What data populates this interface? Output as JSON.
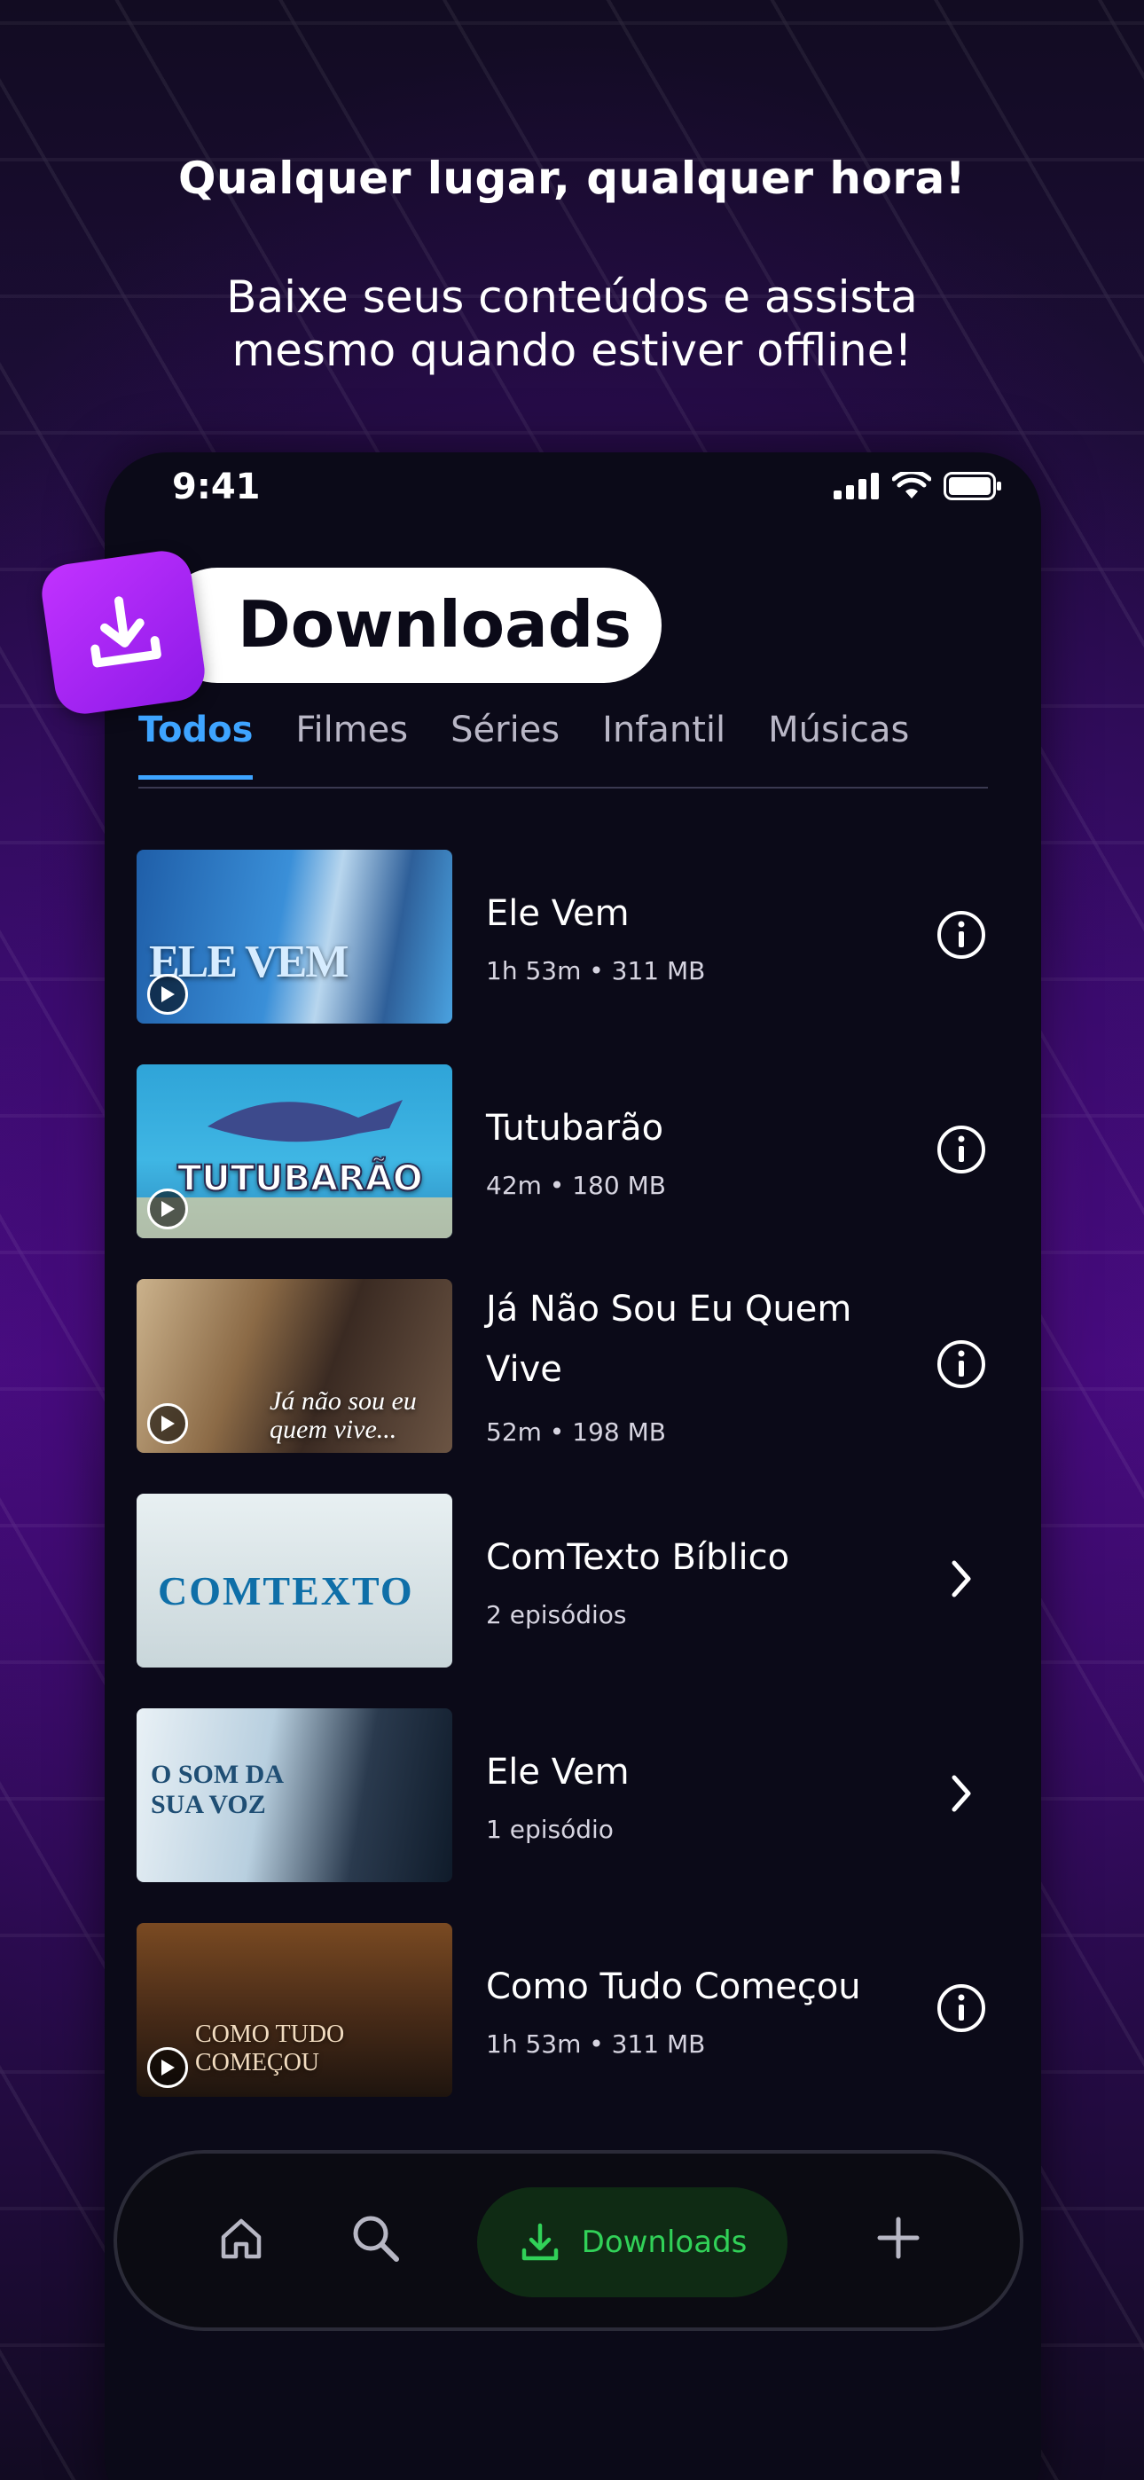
{
  "hero": {
    "title": "Qualquer lugar, qualquer hora!",
    "subtitle_line1": "Baixe seus conteúdos e assista",
    "subtitle_line2": "mesmo quando estiver offline!"
  },
  "status_bar": {
    "time": "9:41"
  },
  "header": {
    "title": "Downloads"
  },
  "tabs": [
    {
      "label": "Todos",
      "active": true
    },
    {
      "label": "Filmes",
      "active": false
    },
    {
      "label": "Séries",
      "active": false
    },
    {
      "label": "Infantil",
      "active": false
    },
    {
      "label": "Músicas",
      "active": false
    }
  ],
  "items": [
    {
      "title": "Ele Vem",
      "meta": "1h 53m • 311 MB",
      "action": "info-icon",
      "thumb_text": "ELE VEM",
      "has_play": true
    },
    {
      "title": "Tutubarão",
      "meta": "42m • 180 MB",
      "action": "info-icon",
      "thumb_text": "TUTUBARÃO",
      "has_play": true
    },
    {
      "title": "Já Não Sou Eu Quem Vive",
      "meta": "52m • 198 MB",
      "action": "info-icon",
      "thumb_text": "Já não sou eu quem vive...",
      "has_play": true
    },
    {
      "title": "ComTexto Bíblico",
      "meta": "2 episódios",
      "action": "chevron-right-icon",
      "thumb_text": "COMTEXTO",
      "has_play": false
    },
    {
      "title": "Ele Vem",
      "meta": "1 episódio",
      "action": "chevron-right-icon",
      "thumb_text": "O SOM DA SUA VOZ",
      "has_play": false
    },
    {
      "title": "Como Tudo Começou",
      "meta": "1h 53m • 311 MB",
      "action": "info-icon",
      "thumb_text": "COMO TUDO COMEÇOU",
      "has_play": true
    }
  ],
  "nav": {
    "downloads_label": "Downloads"
  },
  "colors": {
    "accent_tab": "#3ea4ff",
    "accent_nav": "#31d158",
    "badge_purple": "#b42cf6"
  }
}
